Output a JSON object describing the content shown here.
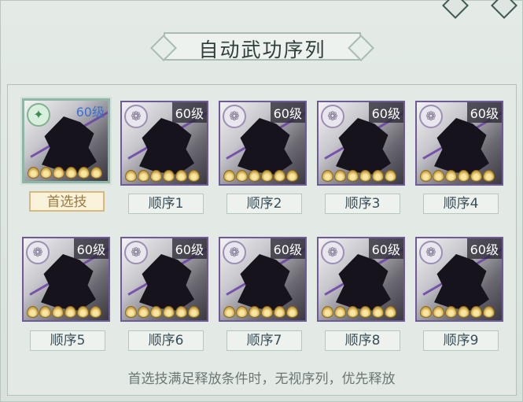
{
  "title": "自动武功序列",
  "skills": [
    {
      "level": "60级",
      "tag": "首选技"
    },
    {
      "level": "60级",
      "tag": "顺序1"
    },
    {
      "level": "60级",
      "tag": "顺序2"
    },
    {
      "level": "60级",
      "tag": "顺序3"
    },
    {
      "level": "60级",
      "tag": "顺序4"
    },
    {
      "level": "60级",
      "tag": "顺序5"
    },
    {
      "level": "60级",
      "tag": "顺序6"
    },
    {
      "level": "60级",
      "tag": "顺序7"
    },
    {
      "level": "60级",
      "tag": "顺序8"
    },
    {
      "level": "60级",
      "tag": "顺序9"
    }
  ],
  "footer_note": "首选技满足释放条件时，无视序列，优先释放",
  "colors": {
    "accent_border": "#6e5a97",
    "primary_tag": "#d7b97b",
    "level_blue": "#3c6fd0"
  },
  "icons": {
    "primary_skill": "arrow-emblem-icon",
    "skill": "swirl-emblem-icon",
    "upgrade": "flame-icon"
  }
}
